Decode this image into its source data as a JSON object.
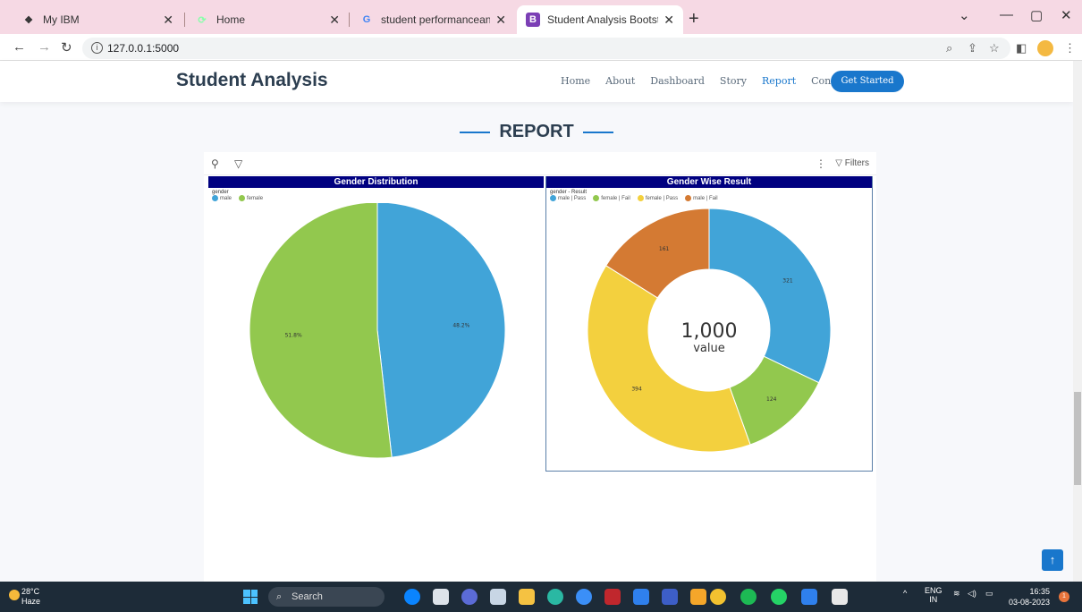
{
  "browser": {
    "tabs": [
      {
        "title": "My IBM"
      },
      {
        "title": "Home"
      },
      {
        "title": "student performanceanalysis ima"
      },
      {
        "title": "Student Analysis Bootstrap Temp"
      }
    ],
    "url": "127.0.0.1:5000"
  },
  "site": {
    "brand": "Student Analysis",
    "nav": [
      "Home",
      "About",
      "Dashboard",
      "Story",
      "Report",
      "Contact"
    ],
    "active_nav": "Report",
    "cta_label": "Get Started",
    "section_title": "REPORT"
  },
  "report_toolbar": {
    "filters_label": "Filters",
    "more_label": "⋮"
  },
  "charts": [
    {
      "title": "Gender Distribution",
      "legend_title": "gender",
      "legend": [
        {
          "label": "male",
          "color": "#41a4d8"
        },
        {
          "label": "female",
          "color": "#92c84e"
        }
      ]
    },
    {
      "title": "Gender Wise Result",
      "legend_title": "gender - Result",
      "legend": [
        {
          "label": "male | Pass",
          "color": "#41a4d8"
        },
        {
          "label": "female | Fail",
          "color": "#92c84e"
        },
        {
          "label": "female | Pass",
          "color": "#f3d03e"
        },
        {
          "label": "male | Fail",
          "color": "#d47a33"
        }
      ],
      "center_value": "1,000",
      "center_label": "value"
    }
  ],
  "chart_data": [
    {
      "type": "pie",
      "title": "Gender Distribution",
      "categories": [
        "male",
        "female"
      ],
      "values": [
        48.2,
        51.8
      ],
      "labels": [
        "48.2%",
        "51.8%"
      ],
      "colors": [
        "#41a4d8",
        "#92c84e"
      ]
    },
    {
      "type": "pie",
      "title": "Gender Wise Result",
      "categories": [
        "male | Pass",
        "female | Fail",
        "female | Pass",
        "male | Fail"
      ],
      "values": [
        321,
        124,
        394,
        161
      ],
      "labels": [
        "321",
        "124",
        "394",
        "161"
      ],
      "colors": [
        "#41a4d8",
        "#92c84e",
        "#f3d03e",
        "#d47a33"
      ]
    }
  ],
  "taskbar": {
    "weather_temp": "28°C",
    "weather_desc": "Haze",
    "search_label": "Search",
    "lang": "ENG",
    "region": "IN",
    "time": "16:35",
    "date": "03-08-2023",
    "notif_count": "1"
  }
}
